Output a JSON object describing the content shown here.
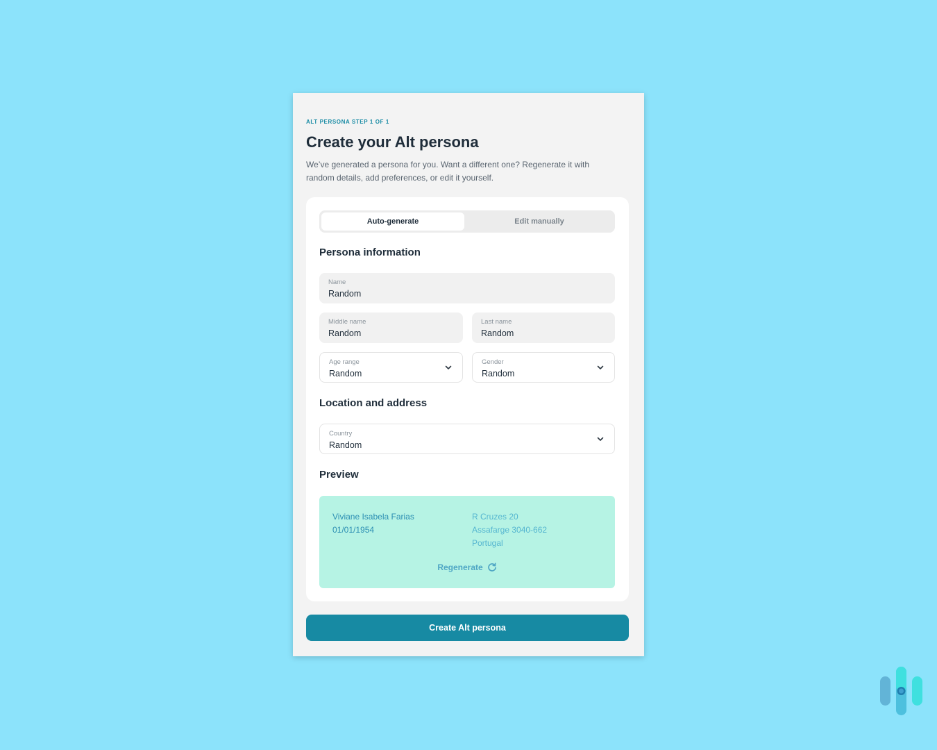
{
  "header": {
    "eyebrow": "ALT PERSONA STEP 1 OF 1",
    "title": "Create your Alt persona",
    "subtitle": "We’ve generated a persona for you. Want a different one? Regenerate it with random details, add preferences, or edit it yourself."
  },
  "tabs": [
    {
      "label": "Auto-generate",
      "active": true
    },
    {
      "label": "Edit manually",
      "active": false
    }
  ],
  "persona_info": {
    "title": "Persona information",
    "name": {
      "label": "Name",
      "value": "Random"
    },
    "middle_name": {
      "label": "Middle name",
      "value": "Random"
    },
    "last_name": {
      "label": "Last name",
      "value": "Random"
    },
    "age_range": {
      "label": "Age range",
      "value": "Random"
    },
    "gender": {
      "label": "Gender",
      "value": "Random"
    }
  },
  "location": {
    "title": "Location and address",
    "country": {
      "label": "Country",
      "value": "Random"
    }
  },
  "preview": {
    "title": "Preview",
    "full_name": "Viviane Isabela Farias",
    "dob": "01/01/1954",
    "street": "R Cruzes 20",
    "city": "Assafarge 3040-662",
    "country": "Portugal",
    "regenerate_label": "Regenerate"
  },
  "cta": {
    "label": "Create Alt persona"
  },
  "colors": {
    "background": "#8ce3fb",
    "accent": "#178aa3",
    "preview_bg": "#b6f3e4"
  },
  "icons": {
    "chevron": "chevron-down-icon",
    "regenerate": "refresh-icon",
    "brand": "brand-logo"
  }
}
